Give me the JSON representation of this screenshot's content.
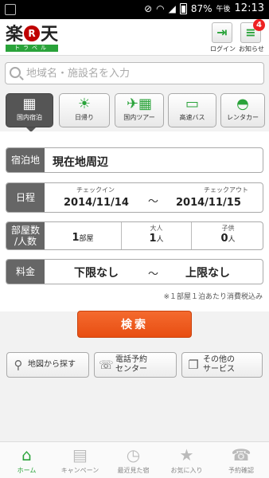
{
  "statusbar": {
    "battery": "87%",
    "ampm": "午後",
    "time": "12:13"
  },
  "header": {
    "logo_text": "楽天",
    "logo_r": "R",
    "logo_sub": "トラベル",
    "login_label": "ログイン",
    "news_label": "お知らせ",
    "news_badge": "4"
  },
  "search": {
    "placeholder": "地域名・施設名を入力"
  },
  "categories": [
    {
      "label": "国内宿泊",
      "icon": "building-icon",
      "active": true
    },
    {
      "label": "日帰り",
      "icon": "sun-icon",
      "active": false
    },
    {
      "label": "国内ツアー",
      "icon": "airplane-building-icon",
      "active": false
    },
    {
      "label": "高速バス",
      "icon": "bus-icon",
      "active": false
    },
    {
      "label": "レンタカー",
      "icon": "car-icon",
      "active": false
    }
  ],
  "form": {
    "place_label": "宿泊地",
    "place_value": "現在地周辺",
    "date_label": "日程",
    "checkin_label": "チェックイン",
    "checkin_value": "2014/11/14",
    "checkout_label": "チェックアウト",
    "checkout_value": "2014/11/15",
    "date_sep": "～",
    "people_label": "部屋数/人数",
    "rooms_value": "1",
    "rooms_unit": "部屋",
    "adults_label": "大人",
    "adults_value": "1",
    "adults_unit": "人",
    "children_label": "子供",
    "children_value": "0",
    "children_unit": "人",
    "price_label": "料金",
    "price_min": "下限なし",
    "price_sep": "～",
    "price_max": "上限なし",
    "note": "※１部屋１泊あたり消費税込み"
  },
  "search_button": "検索",
  "links": {
    "map": "地図から探す",
    "phone": "電話予約\nセンター",
    "other": "その他の\nサービス"
  },
  "tabs": [
    {
      "label": "ホーム",
      "active": true
    },
    {
      "label": "キャンペーン",
      "active": false
    },
    {
      "label": "最近見た宿",
      "active": false
    },
    {
      "label": "お気に入り",
      "active": false
    },
    {
      "label": "予約確認",
      "active": false
    }
  ],
  "colors": {
    "brand_red": "#bf0000",
    "brand_green": "#2aa33a",
    "search_orange": "#e84e12",
    "label_gray": "#666666"
  }
}
